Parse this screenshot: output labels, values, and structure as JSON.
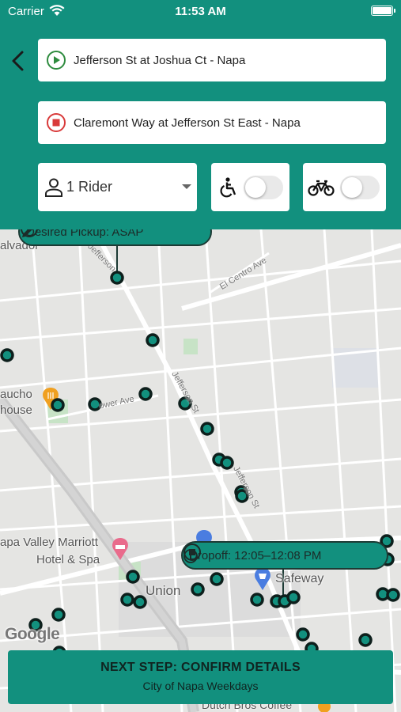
{
  "status_bar": {
    "carrier": "Carrier",
    "time": "11:53 AM"
  },
  "trip": {
    "origin": "Jefferson St at Joshua Ct - Napa",
    "destination": "Claremont Way at Jefferson St East - Napa"
  },
  "riders": {
    "label": "1 Rider"
  },
  "options": {
    "wheelchair_on": false,
    "bike_on": false
  },
  "map": {
    "labels": {
      "salvador": "alvador",
      "gaucho": "aucho",
      "house": "house",
      "marriott1": "apa Valley Marriott",
      "marriott2": "Hotel & Spa",
      "union": "Union",
      "safeway": "Safeway",
      "dutch": "Dutch Bros Coffee"
    },
    "streets": {
      "el_centro": "El Centro Ave",
      "jefferson1": "Jefferson",
      "jefferson2": "Jefferson St",
      "jefferson3": "Jeffe...",
      "power": "ower Ave"
    },
    "google": "Google",
    "pickup_callout": "Desired Pickup: ASAP",
    "dropoff_callout": "Dropoff: 12:05–12:08 PM"
  },
  "next_step": {
    "title": "NEXT STEP: CONFIRM DETAILS",
    "subtitle": "City of Napa Weekdays"
  },
  "colors": {
    "brand": "#12907e",
    "origin_green": "#2e8b3e",
    "dest_red": "#d93a3a",
    "stop_fill": "#12907e",
    "stop_border": "#0d1f1c"
  }
}
